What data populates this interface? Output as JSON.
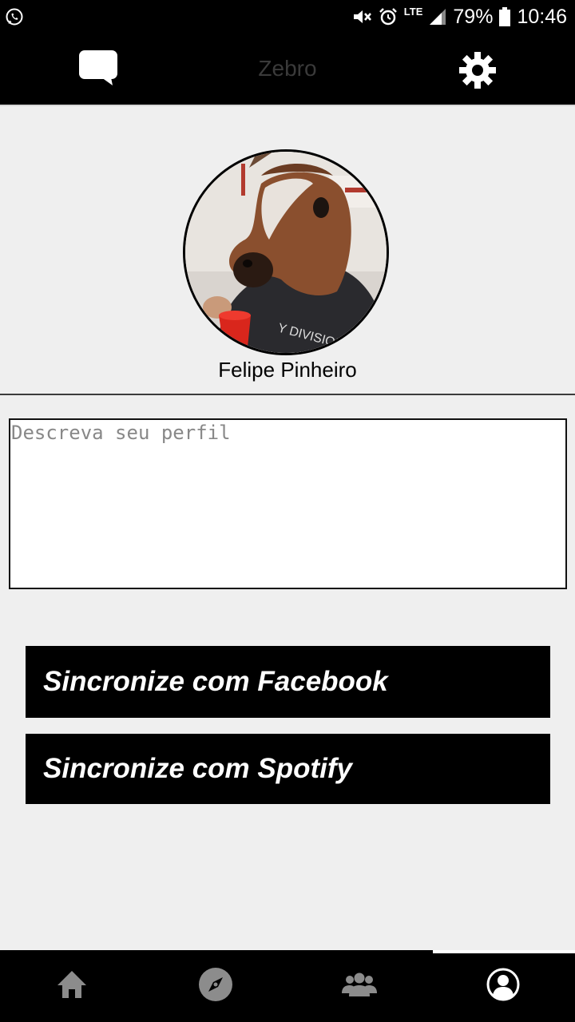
{
  "status_bar": {
    "battery_percent": "79%",
    "time": "10:46",
    "network_label": "LTE",
    "icons": [
      "whatsapp-icon",
      "mute-icon",
      "alarm-icon",
      "signal-icon",
      "battery-icon"
    ]
  },
  "app_bar": {
    "title": "Zebro",
    "left_icon": "chat-icon",
    "right_icon": "gear-icon"
  },
  "profile": {
    "name": "Felipe Pinheiro"
  },
  "description": {
    "placeholder": "Descreva seu perfil",
    "value": ""
  },
  "buttons": {
    "facebook_label": "Sincronize com Facebook",
    "spotify_label": "Sincronize com Spotify"
  },
  "bottom_nav": {
    "items": [
      "home-icon",
      "compass-icon",
      "people-icon",
      "profile-icon"
    ],
    "active": "profile-icon"
  },
  "colors": {
    "bar_background": "#000000",
    "page_background": "#efefef",
    "button_background": "#000000",
    "button_text": "#ffffff",
    "title_color": "#3a3a3a"
  }
}
